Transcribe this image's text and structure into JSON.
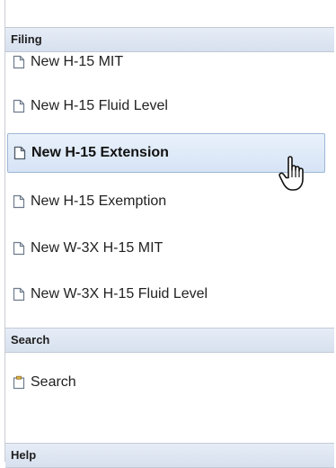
{
  "sections": [
    {
      "title": "Filing",
      "items": [
        {
          "label": "New H-15 MIT",
          "icon": "document-icon"
        },
        {
          "label": "New H-15 Fluid Level",
          "icon": "document-icon"
        },
        {
          "label": "New H-15 Extension",
          "icon": "document-icon",
          "selected": true
        },
        {
          "label": "New H-15 Exemption",
          "icon": "document-icon"
        },
        {
          "label": "New W-3X H-15 MIT",
          "icon": "document-icon"
        },
        {
          "label": "New W-3X H-15 Fluid Level",
          "icon": "document-icon"
        }
      ]
    },
    {
      "title": "Search",
      "items": [
        {
          "label": "Search",
          "icon": "clipboard-icon"
        }
      ]
    },
    {
      "title": "Help",
      "items": []
    }
  ],
  "cursor": "hand-pointer-cursor",
  "colors": {
    "header_bg": "#dde5f1",
    "selected_bg": "#dbe7f7",
    "selected_border": "#9db6d6",
    "text": "#222222"
  }
}
